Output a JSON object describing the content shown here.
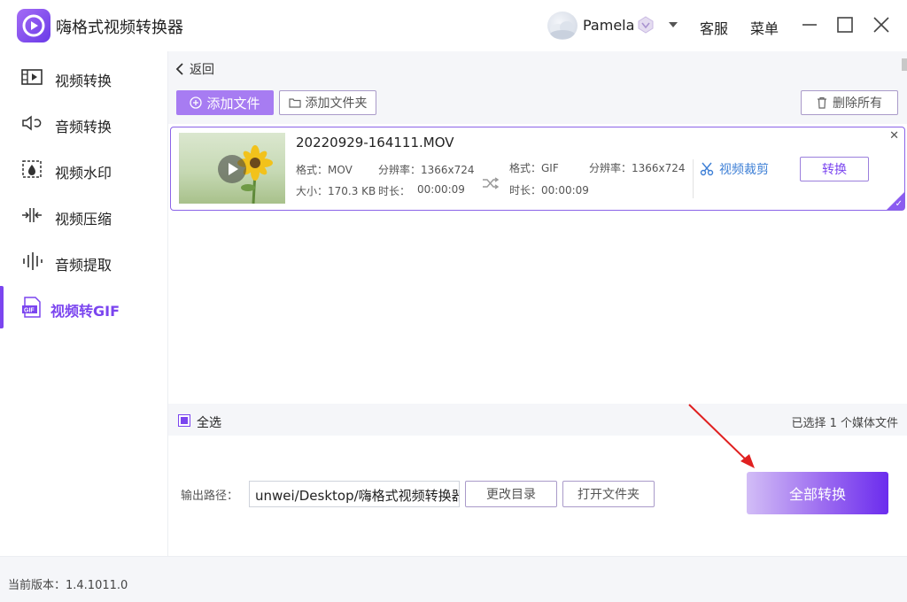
{
  "app": {
    "title": "嗨格式视频转换器"
  },
  "titlebar": {
    "username": "Pamela",
    "service": "客服",
    "menu": "菜单"
  },
  "sidebar": {
    "items": [
      {
        "label": "视频转换",
        "icon": "video-convert-icon"
      },
      {
        "label": "音频转换",
        "icon": "audio-convert-icon"
      },
      {
        "label": "视频水印",
        "icon": "watermark-icon"
      },
      {
        "label": "视频压缩",
        "icon": "compress-icon"
      },
      {
        "label": "音频提取",
        "icon": "audio-extract-icon"
      },
      {
        "label": "视频转GIF",
        "icon": "gif-icon",
        "active": true
      }
    ]
  },
  "main": {
    "back": "返回",
    "add_file": "添加文件",
    "add_folder": "添加文件夹",
    "delete_all": "删除所有"
  },
  "file": {
    "name": "20220929-164111.MOV",
    "src_format": "格式：MOV",
    "src_resolution": "分辨率：1366x724",
    "src_size": "大小：170.3 KB",
    "src_duration_label": "时长：",
    "src_duration": "00:00:09",
    "dst_format": "格式：GIF",
    "dst_resolution": "分辨率：1366x724",
    "dst_duration": "时长：00:00:09",
    "crop": "视频裁剪",
    "convert": "转换"
  },
  "selection": {
    "select_all": "全选",
    "count_text": "已选择 1 个媒体文件"
  },
  "output": {
    "label": "输出路径：",
    "path": "unwei/Desktop/嗨格式视频转换器",
    "change_dir": "更改目录",
    "open_folder": "打开文件夹",
    "convert_all": "全部转换"
  },
  "status": {
    "version": "当前版本：1.4.1011.0"
  },
  "colors": {
    "accent": "#7b45ef",
    "link": "#3d7fd6",
    "annotation": "#e02020"
  }
}
